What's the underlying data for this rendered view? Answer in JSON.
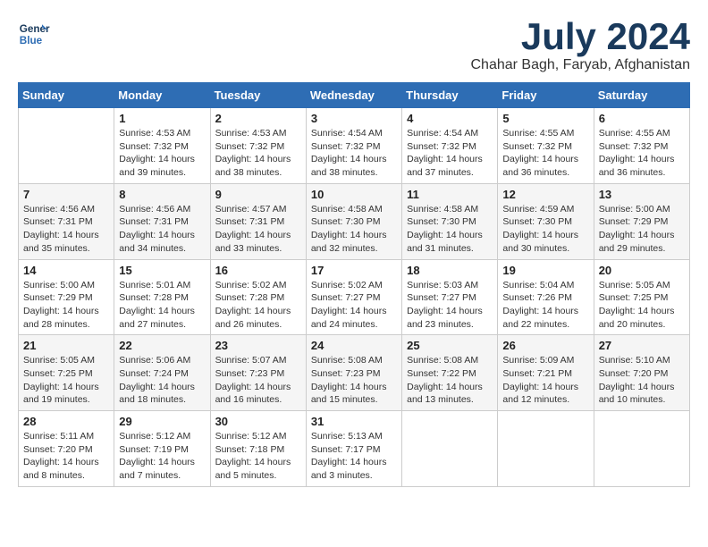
{
  "header": {
    "logo_line1": "General",
    "logo_line2": "Blue",
    "month_title": "July 2024",
    "subtitle": "Chahar Bagh, Faryab, Afghanistan"
  },
  "weekdays": [
    "Sunday",
    "Monday",
    "Tuesday",
    "Wednesday",
    "Thursday",
    "Friday",
    "Saturday"
  ],
  "weeks": [
    [
      {
        "day": "",
        "info": ""
      },
      {
        "day": "1",
        "info": "Sunrise: 4:53 AM\nSunset: 7:32 PM\nDaylight: 14 hours\nand 39 minutes."
      },
      {
        "day": "2",
        "info": "Sunrise: 4:53 AM\nSunset: 7:32 PM\nDaylight: 14 hours\nand 38 minutes."
      },
      {
        "day": "3",
        "info": "Sunrise: 4:54 AM\nSunset: 7:32 PM\nDaylight: 14 hours\nand 38 minutes."
      },
      {
        "day": "4",
        "info": "Sunrise: 4:54 AM\nSunset: 7:32 PM\nDaylight: 14 hours\nand 37 minutes."
      },
      {
        "day": "5",
        "info": "Sunrise: 4:55 AM\nSunset: 7:32 PM\nDaylight: 14 hours\nand 36 minutes."
      },
      {
        "day": "6",
        "info": "Sunrise: 4:55 AM\nSunset: 7:32 PM\nDaylight: 14 hours\nand 36 minutes."
      }
    ],
    [
      {
        "day": "7",
        "info": "Sunrise: 4:56 AM\nSunset: 7:31 PM\nDaylight: 14 hours\nand 35 minutes."
      },
      {
        "day": "8",
        "info": "Sunrise: 4:56 AM\nSunset: 7:31 PM\nDaylight: 14 hours\nand 34 minutes."
      },
      {
        "day": "9",
        "info": "Sunrise: 4:57 AM\nSunset: 7:31 PM\nDaylight: 14 hours\nand 33 minutes."
      },
      {
        "day": "10",
        "info": "Sunrise: 4:58 AM\nSunset: 7:30 PM\nDaylight: 14 hours\nand 32 minutes."
      },
      {
        "day": "11",
        "info": "Sunrise: 4:58 AM\nSunset: 7:30 PM\nDaylight: 14 hours\nand 31 minutes."
      },
      {
        "day": "12",
        "info": "Sunrise: 4:59 AM\nSunset: 7:30 PM\nDaylight: 14 hours\nand 30 minutes."
      },
      {
        "day": "13",
        "info": "Sunrise: 5:00 AM\nSunset: 7:29 PM\nDaylight: 14 hours\nand 29 minutes."
      }
    ],
    [
      {
        "day": "14",
        "info": "Sunrise: 5:00 AM\nSunset: 7:29 PM\nDaylight: 14 hours\nand 28 minutes."
      },
      {
        "day": "15",
        "info": "Sunrise: 5:01 AM\nSunset: 7:28 PM\nDaylight: 14 hours\nand 27 minutes."
      },
      {
        "day": "16",
        "info": "Sunrise: 5:02 AM\nSunset: 7:28 PM\nDaylight: 14 hours\nand 26 minutes."
      },
      {
        "day": "17",
        "info": "Sunrise: 5:02 AM\nSunset: 7:27 PM\nDaylight: 14 hours\nand 24 minutes."
      },
      {
        "day": "18",
        "info": "Sunrise: 5:03 AM\nSunset: 7:27 PM\nDaylight: 14 hours\nand 23 minutes."
      },
      {
        "day": "19",
        "info": "Sunrise: 5:04 AM\nSunset: 7:26 PM\nDaylight: 14 hours\nand 22 minutes."
      },
      {
        "day": "20",
        "info": "Sunrise: 5:05 AM\nSunset: 7:25 PM\nDaylight: 14 hours\nand 20 minutes."
      }
    ],
    [
      {
        "day": "21",
        "info": "Sunrise: 5:05 AM\nSunset: 7:25 PM\nDaylight: 14 hours\nand 19 minutes."
      },
      {
        "day": "22",
        "info": "Sunrise: 5:06 AM\nSunset: 7:24 PM\nDaylight: 14 hours\nand 18 minutes."
      },
      {
        "day": "23",
        "info": "Sunrise: 5:07 AM\nSunset: 7:23 PM\nDaylight: 14 hours\nand 16 minutes."
      },
      {
        "day": "24",
        "info": "Sunrise: 5:08 AM\nSunset: 7:23 PM\nDaylight: 14 hours\nand 15 minutes."
      },
      {
        "day": "25",
        "info": "Sunrise: 5:08 AM\nSunset: 7:22 PM\nDaylight: 14 hours\nand 13 minutes."
      },
      {
        "day": "26",
        "info": "Sunrise: 5:09 AM\nSunset: 7:21 PM\nDaylight: 14 hours\nand 12 minutes."
      },
      {
        "day": "27",
        "info": "Sunrise: 5:10 AM\nSunset: 7:20 PM\nDaylight: 14 hours\nand 10 minutes."
      }
    ],
    [
      {
        "day": "28",
        "info": "Sunrise: 5:11 AM\nSunset: 7:20 PM\nDaylight: 14 hours\nand 8 minutes."
      },
      {
        "day": "29",
        "info": "Sunrise: 5:12 AM\nSunset: 7:19 PM\nDaylight: 14 hours\nand 7 minutes."
      },
      {
        "day": "30",
        "info": "Sunrise: 5:12 AM\nSunset: 7:18 PM\nDaylight: 14 hours\nand 5 minutes."
      },
      {
        "day": "31",
        "info": "Sunrise: 5:13 AM\nSunset: 7:17 PM\nDaylight: 14 hours\nand 3 minutes."
      },
      {
        "day": "",
        "info": ""
      },
      {
        "day": "",
        "info": ""
      },
      {
        "day": "",
        "info": ""
      }
    ]
  ]
}
